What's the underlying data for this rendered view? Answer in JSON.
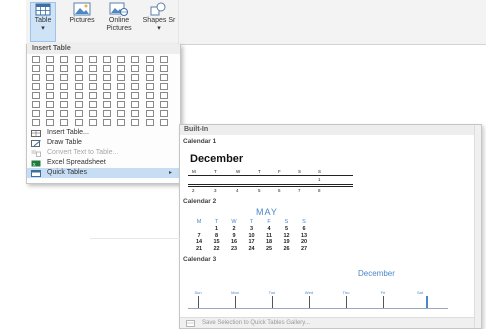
{
  "ribbon": {
    "table": {
      "label": "Table",
      "arrow": "▾"
    },
    "pictures": {
      "label": "Pictures"
    },
    "online_pictures": {
      "line1": "Online",
      "line2": "Pictures"
    },
    "shapes": {
      "label": "Shapes",
      "extra": "Sr",
      "arrow": "▾"
    }
  },
  "insert_table": {
    "header": "Insert Table",
    "rows": 8,
    "cols": 10
  },
  "menu": {
    "items": [
      {
        "label": "Insert Table...",
        "icon": "insert-table-icon",
        "disabled": false
      },
      {
        "label": "Draw Table",
        "icon": "draw-table-icon",
        "disabled": false
      },
      {
        "label": "Convert Text to Table...",
        "icon": "convert-text-icon",
        "disabled": true
      },
      {
        "label": "Excel Spreadsheet",
        "icon": "excel-icon",
        "disabled": false
      },
      {
        "label": "Quick Tables",
        "icon": "quick-tables-icon",
        "disabled": false,
        "submenu_arrow": "▸"
      }
    ]
  },
  "gallery": {
    "header": "Built-In",
    "calendar1": {
      "label": "Calendar 1",
      "month": "December",
      "days": [
        "M",
        "T",
        "W",
        "T",
        "F",
        "S",
        "S"
      ],
      "row1": [
        "1"
      ],
      "row2": [
        "2",
        "3",
        "4",
        "5",
        "6",
        "7",
        "8"
      ]
    },
    "calendar2": {
      "label": "Calendar 2",
      "month": "MAY",
      "days": [
        "M",
        "T",
        "W",
        "T",
        "F",
        "S",
        "S"
      ],
      "weeks": [
        [
          "",
          "1",
          "2",
          "3",
          "4",
          "5",
          "6"
        ],
        [
          "7",
          "8",
          "9",
          "10",
          "11",
          "12",
          "13"
        ],
        [
          "14",
          "15",
          "16",
          "17",
          "18",
          "19",
          "20"
        ],
        [
          "21",
          "22",
          "23",
          "24",
          "25",
          "26",
          "27"
        ]
      ]
    },
    "calendar3": {
      "label": "Calendar 3",
      "month": "December",
      "days": [
        "Sun",
        "Mon",
        "Tue",
        "Wed",
        "Thu",
        "Fri",
        "Sat"
      ]
    },
    "save_label": "Save Selection to Quick Tables Gallery..."
  },
  "colors": {
    "accent": "#4a86c8",
    "highlight": "#c6ddf3"
  }
}
